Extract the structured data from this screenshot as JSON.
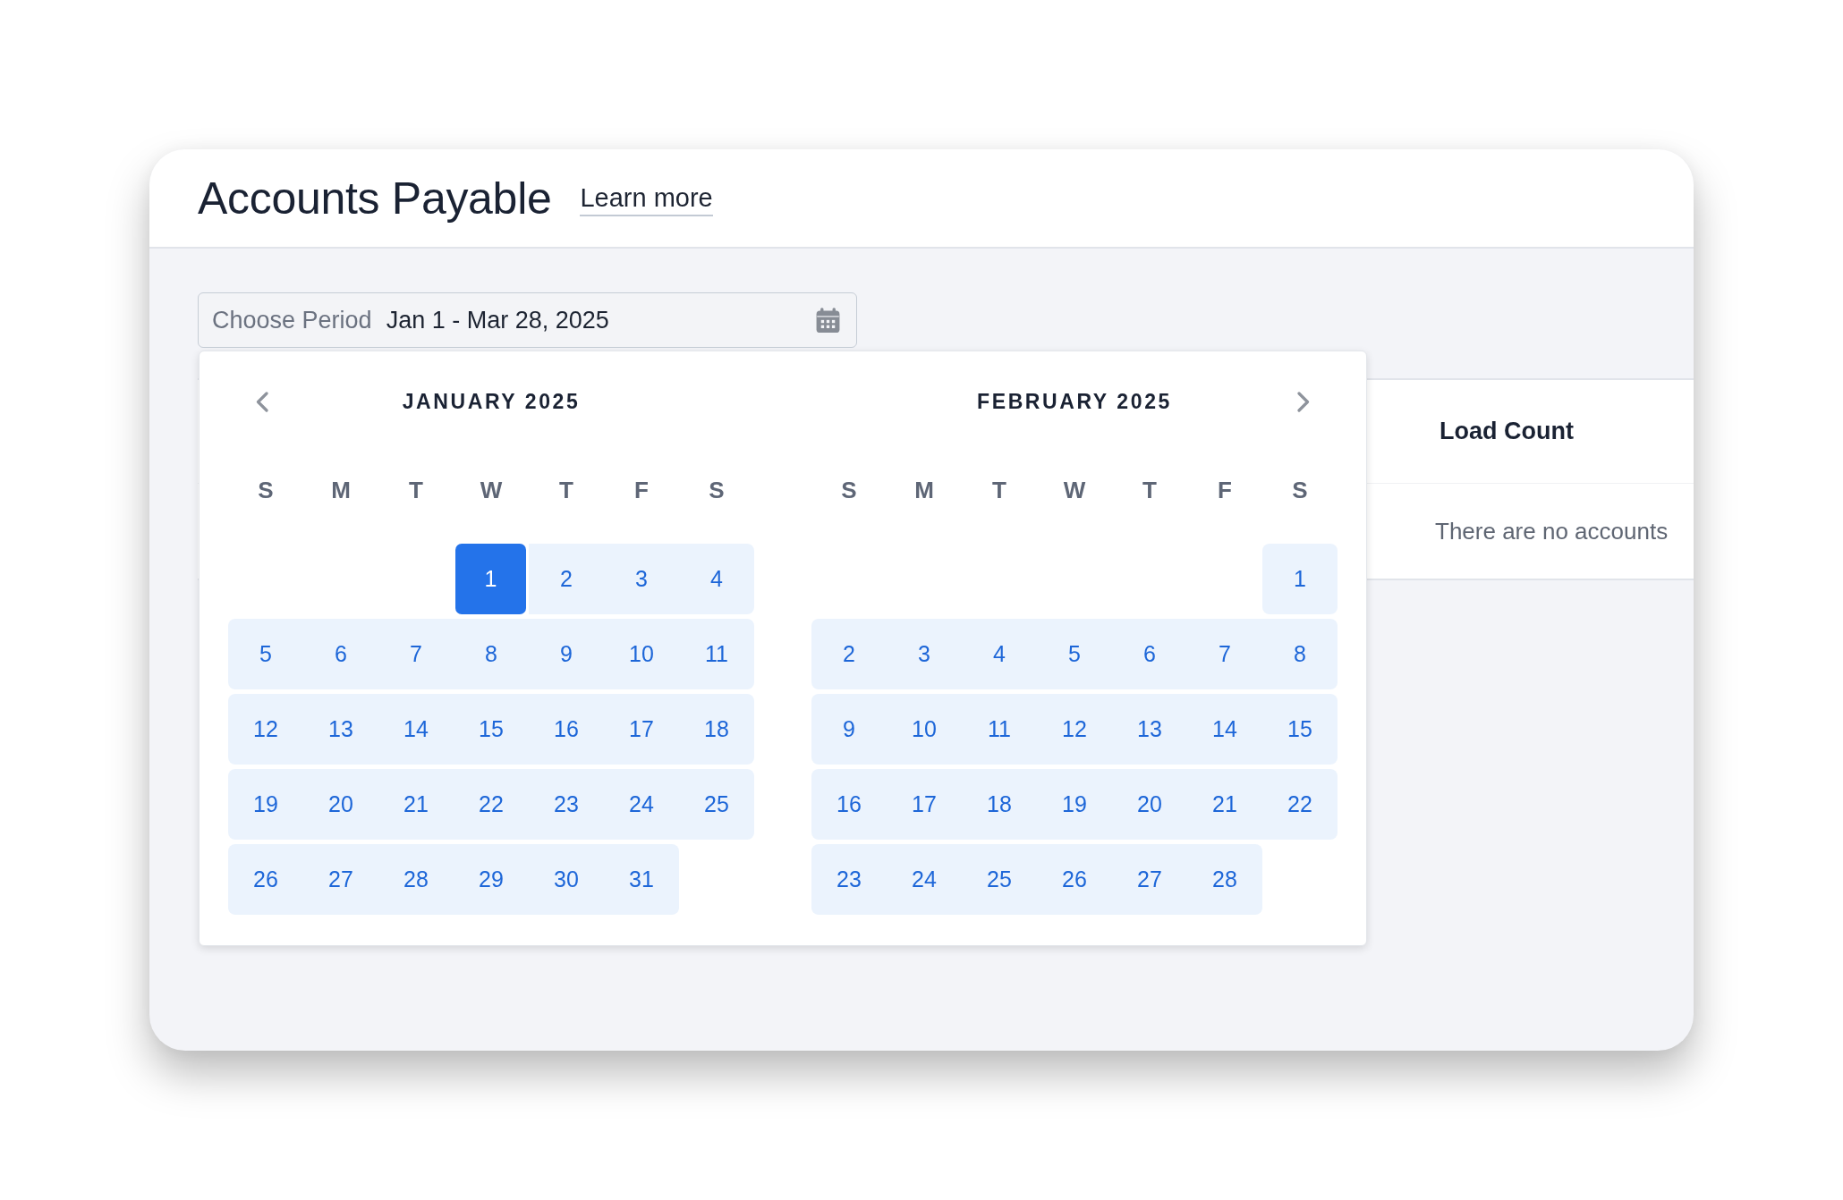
{
  "header": {
    "title": "Accounts Payable",
    "link": "Learn more"
  },
  "period_field": {
    "label": "Choose Period",
    "value": "Jan 1 - Mar 28, 2025"
  },
  "calendar": {
    "months": [
      {
        "title": "JANUARY 2025",
        "weekdays": [
          "S",
          "M",
          "T",
          "W",
          "T",
          "F",
          "S"
        ],
        "weeks": [
          {
            "days": [
              {
                "label": "1",
                "selected": true,
                "in_range": true
              },
              {
                "label": "2",
                "selected": false,
                "in_range": true
              },
              {
                "label": "3",
                "selected": false,
                "in_range": true
              },
              {
                "label": "4",
                "selected": false,
                "in_range": true
              }
            ]
          },
          {
            "days": [
              {
                "label": "5",
                "selected": false,
                "in_range": true
              },
              {
                "label": "6",
                "selected": false,
                "in_range": true
              },
              {
                "label": "7",
                "selected": false,
                "in_range": true
              },
              {
                "label": "8",
                "selected": false,
                "in_range": true
              },
              {
                "label": "9",
                "selected": false,
                "in_range": true
              },
              {
                "label": "10",
                "selected": false,
                "in_range": true
              },
              {
                "label": "11",
                "selected": false,
                "in_range": true
              }
            ]
          },
          {
            "days": [
              {
                "label": "12",
                "selected": false,
                "in_range": true
              },
              {
                "label": "13",
                "selected": false,
                "in_range": true
              },
              {
                "label": "14",
                "selected": false,
                "in_range": true
              },
              {
                "label": "15",
                "selected": false,
                "in_range": true
              },
              {
                "label": "16",
                "selected": false,
                "in_range": true
              },
              {
                "label": "17",
                "selected": false,
                "in_range": true
              },
              {
                "label": "18",
                "selected": false,
                "in_range": true
              }
            ]
          },
          {
            "days": [
              {
                "label": "19",
                "selected": false,
                "in_range": true
              },
              {
                "label": "20",
                "selected": false,
                "in_range": true
              },
              {
                "label": "21",
                "selected": false,
                "in_range": true
              },
              {
                "label": "22",
                "selected": false,
                "in_range": true
              },
              {
                "label": "23",
                "selected": false,
                "in_range": true
              },
              {
                "label": "24",
                "selected": false,
                "in_range": true
              },
              {
                "label": "25",
                "selected": false,
                "in_range": true
              }
            ]
          },
          {
            "days": [
              {
                "label": "26",
                "selected": false,
                "in_range": true
              },
              {
                "label": "27",
                "selected": false,
                "in_range": true
              },
              {
                "label": "28",
                "selected": false,
                "in_range": true
              },
              {
                "label": "29",
                "selected": false,
                "in_range": true
              },
              {
                "label": "30",
                "selected": false,
                "in_range": true
              },
              {
                "label": "31",
                "selected": false,
                "in_range": true
              }
            ]
          }
        ]
      },
      {
        "title": "FEBRUARY 2025",
        "weekdays": [
          "S",
          "M",
          "T",
          "W",
          "T",
          "F",
          "S"
        ],
        "weeks": [
          {
            "days": [
              {
                "label": "1",
                "selected": false,
                "in_range": true
              }
            ]
          },
          {
            "days": [
              {
                "label": "2",
                "selected": false,
                "in_range": true
              },
              {
                "label": "3",
                "selected": false,
                "in_range": true
              },
              {
                "label": "4",
                "selected": false,
                "in_range": true
              },
              {
                "label": "5",
                "selected": false,
                "in_range": true
              },
              {
                "label": "6",
                "selected": false,
                "in_range": true
              },
              {
                "label": "7",
                "selected": false,
                "in_range": true
              },
              {
                "label": "8",
                "selected": false,
                "in_range": true
              }
            ]
          },
          {
            "days": [
              {
                "label": "9",
                "selected": false,
                "in_range": true
              },
              {
                "label": "10",
                "selected": false,
                "in_range": true
              },
              {
                "label": "11",
                "selected": false,
                "in_range": true
              },
              {
                "label": "12",
                "selected": false,
                "in_range": true
              },
              {
                "label": "13",
                "selected": false,
                "in_range": true
              },
              {
                "label": "14",
                "selected": false,
                "in_range": true
              },
              {
                "label": "15",
                "selected": false,
                "in_range": true
              }
            ]
          },
          {
            "days": [
              {
                "label": "16",
                "selected": false,
                "in_range": true
              },
              {
                "label": "17",
                "selected": false,
                "in_range": true
              },
              {
                "label": "18",
                "selected": false,
                "in_range": true
              },
              {
                "label": "19",
                "selected": false,
                "in_range": true
              },
              {
                "label": "20",
                "selected": false,
                "in_range": true
              },
              {
                "label": "21",
                "selected": false,
                "in_range": true
              },
              {
                "label": "22",
                "selected": false,
                "in_range": true
              }
            ]
          },
          {
            "days": [
              {
                "label": "23",
                "selected": false,
                "in_range": true
              },
              {
                "label": "24",
                "selected": false,
                "in_range": true
              },
              {
                "label": "25",
                "selected": false,
                "in_range": true
              },
              {
                "label": "26",
                "selected": false,
                "in_range": true
              },
              {
                "label": "27",
                "selected": false,
                "in_range": true
              },
              {
                "label": "28",
                "selected": false,
                "in_range": true
              }
            ]
          }
        ]
      }
    ]
  },
  "table": {
    "columns": [
      "Load Count"
    ],
    "empty_message": "There are no accounts"
  }
}
